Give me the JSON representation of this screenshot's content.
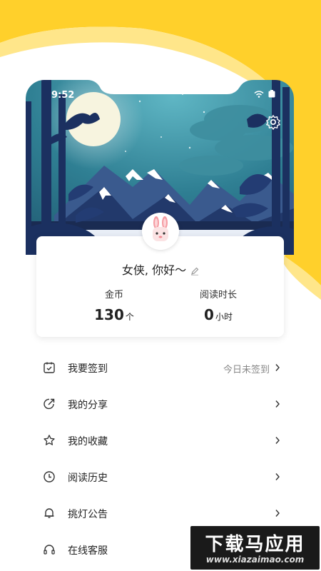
{
  "status_bar": {
    "time": "9:52"
  },
  "profile": {
    "greeting": "女侠, 你好～",
    "stats": [
      {
        "label": "金币",
        "value": "130",
        "unit": "个"
      },
      {
        "label": "阅读时长",
        "value": "0",
        "unit": "小时"
      }
    ]
  },
  "menu": {
    "items": [
      {
        "label": "我要签到",
        "status": "今日未签到",
        "icon": "checkin-calendar-icon"
      },
      {
        "label": "我的分享",
        "status": "",
        "icon": "share-icon"
      },
      {
        "label": "我的收藏",
        "status": "",
        "icon": "star-icon"
      },
      {
        "label": "阅读历史",
        "status": "",
        "icon": "clock-icon"
      },
      {
        "label": "挑灯公告",
        "status": "",
        "icon": "bell-icon"
      },
      {
        "label": "在线客服",
        "status": "",
        "icon": "headset-icon"
      }
    ]
  },
  "watermark": {
    "title": "下载马应用",
    "url": "www.xiazaimao.com"
  },
  "colors": {
    "accent_yellow": "#FFD02B",
    "light_yellow": "#FFE36E",
    "night_sky": "#2E7A8C",
    "mountain_dark": "#1F3766"
  }
}
